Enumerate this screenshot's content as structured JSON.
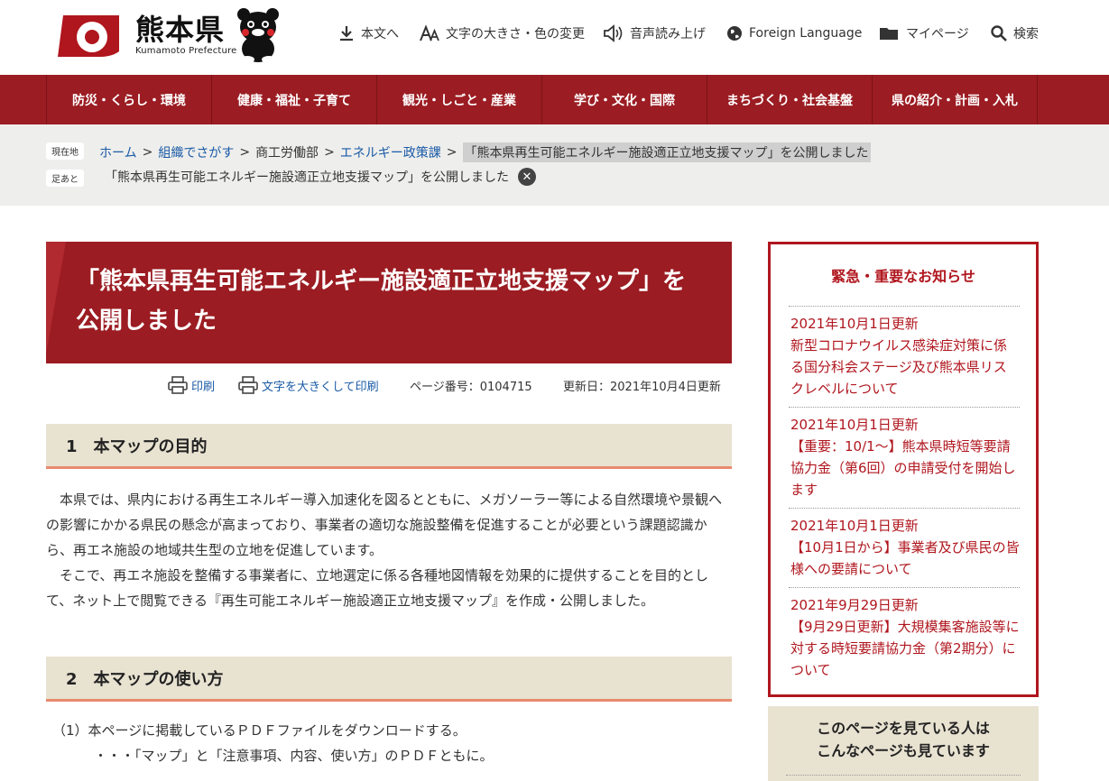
{
  "header": {
    "logo_text": "熊本県",
    "logo_sub": "Kumamoto Prefecture",
    "utilities": {
      "skip": "本文へ",
      "text_size": "文字の大きさ・色の変更",
      "read_aloud": "音声読み上げ",
      "foreign": "Foreign Language",
      "mypage": "マイページ",
      "search": "検索"
    }
  },
  "nav": {
    "items": [
      "防災・くらし・環境",
      "健康・福祉・子育て",
      "観光・しごと・産業",
      "学び・文化・国際",
      "まちづくり・社会基盤",
      "県の紹介・計画・入札"
    ]
  },
  "breadcrumb": {
    "current_tag": "現在地",
    "home": "ホーム",
    "sep": ">",
    "org": "組織でさがす",
    "dept": "商工労働部",
    "section": "エネルギー政策課",
    "current": "「熊本県再生可能エネルギー施設適正立地支援マップ」を公開しました",
    "footprint_tag": "足あと",
    "footprint": "「熊本県再生可能エネルギー施設適正立地支援マップ」を公開しました",
    "close_glyph": "✕"
  },
  "page": {
    "title": "「熊本県再生可能エネルギー施設適正立地支援マップ」を公開しました",
    "print": "印刷",
    "print_large": "文字を大きくして印刷",
    "page_no": "ページ番号：0104715",
    "updated": "更新日：2021年10月4日更新"
  },
  "sections": [
    {
      "heading": "1　本マップの目的",
      "paragraphs": [
        "　本県では、県内における再生エネルギー導入加速化を図るとともに、メガソーラー等による自然環境や景観への影響にかかる県民の懸念が高まっており、事業者の適切な施設整備を促進することが必要という課題認識から、再エネ施設の地域共生型の立地を促進しています。",
        "　そこで、再エネ施設を整備する事業者に、立地選定に係る各種地図情報を効果的に提供することを目的として、ネット上で閲覧できる『再生可能エネルギー施設適正立地支援マップ』を作成・公開しました。"
      ]
    },
    {
      "heading": "2　本マップの使い方",
      "paragraphs": [
        "（1）本ページに掲載しているＰＤＦファイルをダウンロードする。",
        "・・・「マップ」と「注意事項、内容、使い方」のＰＤＦともに。"
      ]
    }
  ],
  "sidebar": {
    "notice_title": "緊急・重要なお知らせ",
    "notices": [
      {
        "date": "2021年10月1日更新",
        "text": "新型コロナウイルス感染症対策に係る国分科会ステージ及び熊本県リスクレベルについて"
      },
      {
        "date": "2021年10月1日更新",
        "text": "【重要：10/1～】熊本県時短等要請協力金（第6回）の申請受付を開始します"
      },
      {
        "date": "2021年10月1日更新",
        "text": "【10月1日から】事業者及び県民の皆様への要請について"
      },
      {
        "date": "2021年9月29日更新",
        "text": "【9月29日更新】大規模集客施設等に対する時短要請協力金（第2期分）について"
      }
    ],
    "related_title_1": "このページを見ている人は",
    "related_title_2": "こんなページも見ています"
  },
  "colors": {
    "brand_red": "#9b1c22",
    "notice_red": "#b0161e",
    "link_blue": "#1a5aa6",
    "section_beige": "#e8e2d1",
    "section_underline": "#e88a6e"
  }
}
